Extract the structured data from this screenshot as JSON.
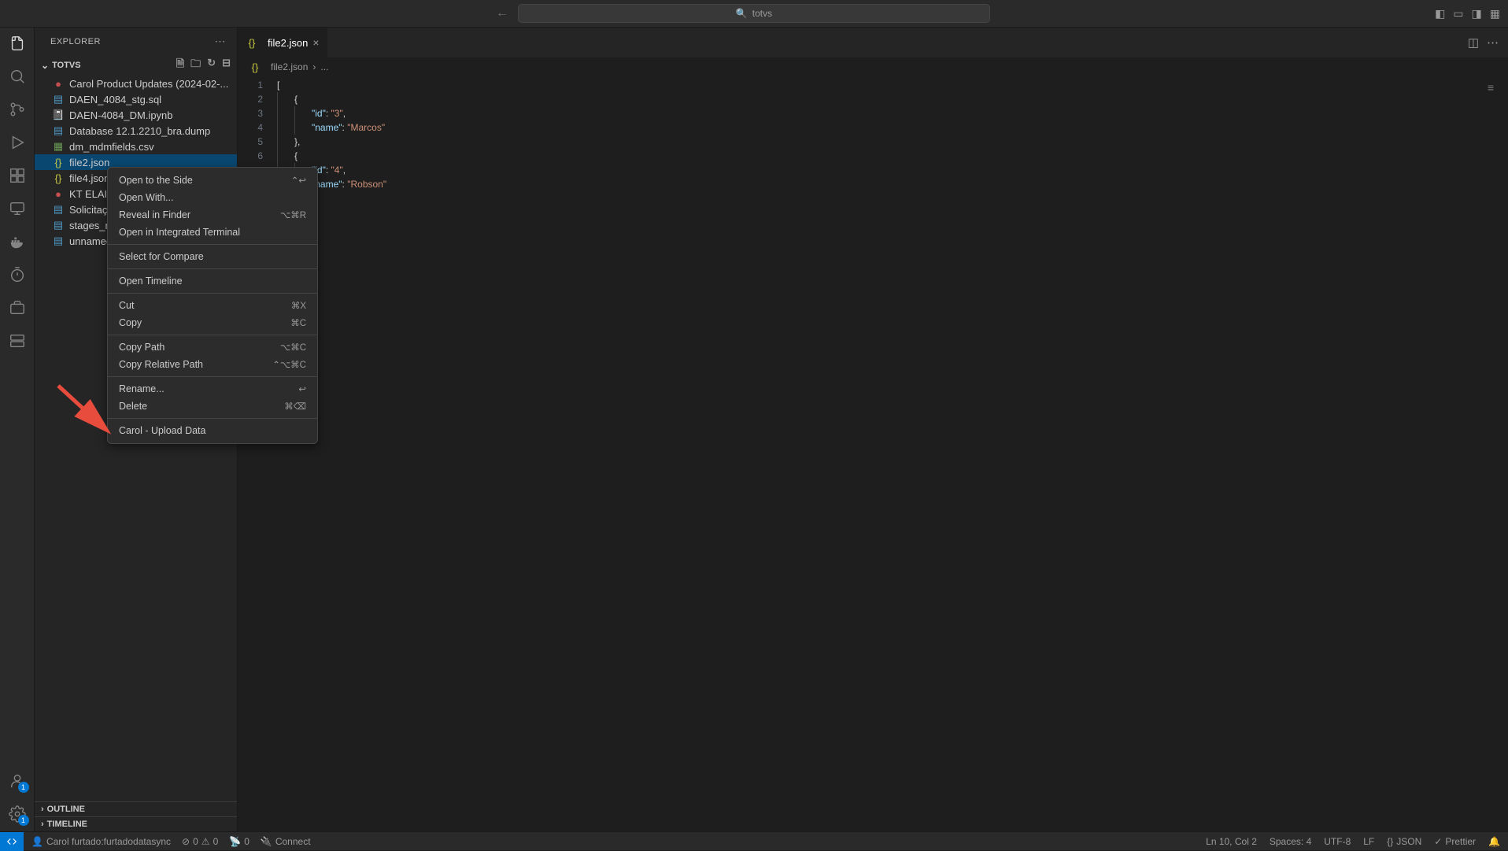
{
  "titlebar": {
    "search": "totvs"
  },
  "sidebar": {
    "title": "EXPLORER",
    "folder": "TOTVS",
    "files": [
      {
        "icon": "●",
        "cls": "icon-red",
        "label": "Carol Product Updates (2024-02-..."
      },
      {
        "icon": "▤",
        "cls": "icon-blue",
        "label": "DAEN_4084_stg.sql"
      },
      {
        "icon": "📓",
        "cls": "icon-orange",
        "label": "DAEN-4084_DM.ipynb"
      },
      {
        "icon": "▤",
        "cls": "icon-blue",
        "label": "Database 12.1.2210_bra.dump"
      },
      {
        "icon": "▦",
        "cls": "icon-green",
        "label": "dm_mdmfields.csv"
      },
      {
        "icon": "{}",
        "cls": "icon-yellow",
        "label": "file2.json"
      },
      {
        "icon": "{}",
        "cls": "icon-yellow",
        "label": "file4.json"
      },
      {
        "icon": "●",
        "cls": "icon-red",
        "label": "KT ELAI ("
      },
      {
        "icon": "▤",
        "cls": "icon-blue",
        "label": "Solicitaç"
      },
      {
        "icon": "▤",
        "cls": "icon-blue",
        "label": "stages_n"
      },
      {
        "icon": "▤",
        "cls": "icon-blue",
        "label": "unnamec"
      }
    ],
    "outline": "OUTLINE",
    "timeline": "TIMELINE"
  },
  "contextMenu": {
    "items": [
      {
        "label": "Open to the Side",
        "short": "⌃↩",
        "sep": false
      },
      {
        "label": "Open With...",
        "short": "",
        "sep": false
      },
      {
        "label": "Reveal in Finder",
        "short": "⌥⌘R",
        "sep": false
      },
      {
        "label": "Open in Integrated Terminal",
        "short": "",
        "sep": true
      },
      {
        "label": "Select for Compare",
        "short": "",
        "sep": true
      },
      {
        "label": "Open Timeline",
        "short": "",
        "sep": true
      },
      {
        "label": "Cut",
        "short": "⌘X",
        "sep": false
      },
      {
        "label": "Copy",
        "short": "⌘C",
        "sep": true
      },
      {
        "label": "Copy Path",
        "short": "⌥⌘C",
        "sep": false
      },
      {
        "label": "Copy Relative Path",
        "short": "⌃⌥⌘C",
        "sep": true
      },
      {
        "label": "Rename...",
        "short": "↩",
        "sep": false
      },
      {
        "label": "Delete",
        "short": "⌘⌫",
        "sep": true
      },
      {
        "label": "Carol - Upload Data",
        "short": "",
        "sep": false
      }
    ]
  },
  "tab": {
    "filename": "file2.json"
  },
  "breadcrumb": {
    "file": "file2.json",
    "rest": "..."
  },
  "code": {
    "lines": [
      "1",
      "2",
      "3",
      "4",
      "5",
      "6"
    ],
    "l1": "[",
    "l2": "{",
    "l3k": "\"id\"",
    "l3c": ": ",
    "l3v": "\"3\"",
    "l3e": ",",
    "l4k": "\"name\"",
    "l4c": ": ",
    "l4v": "\"Marcos\"",
    "l5": "},",
    "l6": "{",
    "l7k": "\"id\"",
    "l7c": ": ",
    "l7v": "\"4\"",
    "l7e": ",",
    "l8k": "\"name\"",
    "l8c": ": ",
    "l8v": "\"Robson\""
  },
  "status": {
    "user": "Carol furtado:furtadodatasync",
    "errors": "0",
    "warnings": "0",
    "ports": "0",
    "connect": "Connect",
    "lncol": "Ln 10, Col 2",
    "spaces": "Spaces: 4",
    "encoding": "UTF-8",
    "eol": "LF",
    "lang": "JSON",
    "prettier": "Prettier"
  }
}
